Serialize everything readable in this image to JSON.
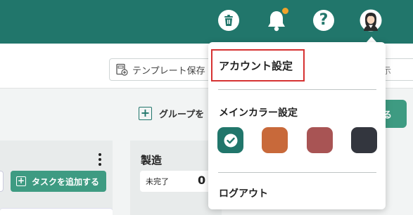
{
  "header": {
    "brand_color": "#21766b",
    "icons": [
      "trash-icon",
      "bell-icon",
      "help-icon",
      "avatar"
    ],
    "notification_dot_color": "#f0a32a",
    "help_glyph": "?"
  },
  "toolbar": {
    "template_button_label": "テンプレート保存",
    "right_button_label": "示"
  },
  "board": {
    "add_group_label": "グループを",
    "right_action_label": "る",
    "columns": [
      {
        "add_task_label": "タスクを追加する"
      },
      {
        "title": "製造",
        "status_label": "未完了",
        "status_count": "0"
      }
    ]
  },
  "account_menu": {
    "account_settings_label": "アカウント設定",
    "main_color_label": "メインカラー設定",
    "colors": [
      {
        "hex": "#21766b",
        "selected": true
      },
      {
        "hex": "#c8693a",
        "selected": false
      },
      {
        "hex": "#a85454",
        "selected": false
      },
      {
        "hex": "#33363e",
        "selected": false
      }
    ],
    "logout_label": "ログアウト"
  }
}
